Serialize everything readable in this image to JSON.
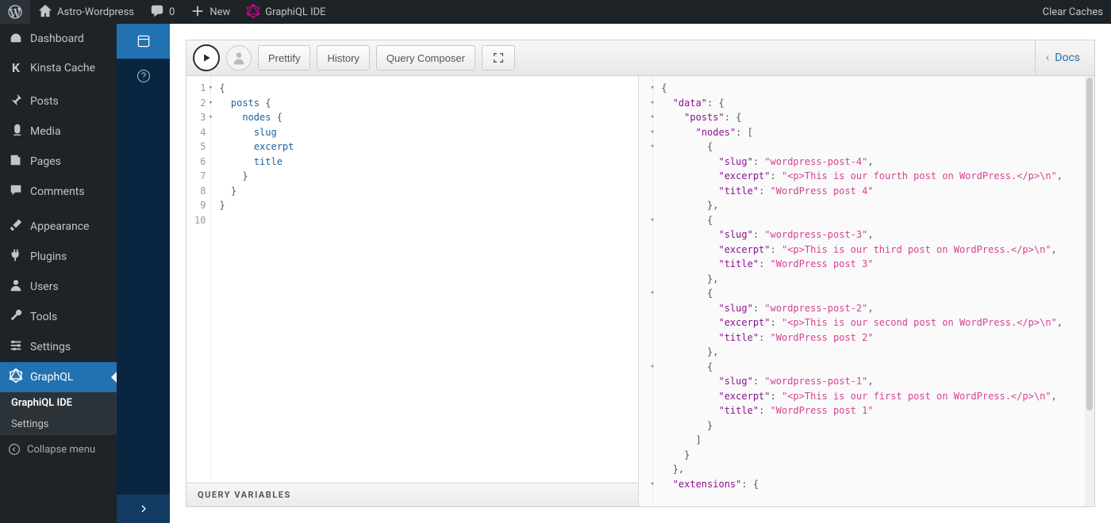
{
  "adminbar": {
    "site_name": "Astro-Wordpress",
    "comments_count": "0",
    "new_label": "New",
    "graphiql_label": "GraphiQL IDE",
    "clear_caches_label": "Clear Caches"
  },
  "adminmenu": {
    "items": [
      {
        "icon": "dash",
        "label": "Dashboard"
      },
      {
        "icon": "k",
        "label": "Kinsta Cache"
      },
      {
        "icon": "pin",
        "label": "Posts"
      },
      {
        "icon": "media",
        "label": "Media"
      },
      {
        "icon": "page",
        "label": "Pages"
      },
      {
        "icon": "comment",
        "label": "Comments"
      },
      {
        "icon": "brush",
        "label": "Appearance"
      },
      {
        "icon": "plug",
        "label": "Plugins"
      },
      {
        "icon": "user",
        "label": "Users"
      },
      {
        "icon": "wrench",
        "label": "Tools"
      },
      {
        "icon": "settings",
        "label": "Settings"
      },
      {
        "icon": "graphql",
        "label": "GraphQL"
      }
    ],
    "submenu": [
      "GraphiQL IDE",
      "Settings"
    ],
    "collapse_label": "Collapse menu"
  },
  "toolbar": {
    "prettify": "Prettify",
    "history": "History",
    "composer": "Query Composer",
    "docs": "Docs"
  },
  "query": {
    "lines": [
      "{",
      "  posts {",
      "    nodes {",
      "      slug",
      "      excerpt",
      "      title",
      "    }",
      "  }",
      "}",
      ""
    ],
    "fields": [
      "posts",
      "nodes",
      "slug",
      "excerpt",
      "title"
    ]
  },
  "query_variables_label": "QUERY VARIABLES",
  "result": {
    "posts": [
      {
        "slug": "wordpress-post-4",
        "excerpt": "<p>This is our fourth post on WordPress.</p>\\n",
        "title": "WordPress post 4"
      },
      {
        "slug": "wordpress-post-3",
        "excerpt": "<p>This is our third post on WordPress.</p>\\n",
        "title": "WordPress post 3"
      },
      {
        "slug": "wordpress-post-2",
        "excerpt": "<p>This is our second post on WordPress.</p>\\n",
        "title": "WordPress post 2"
      },
      {
        "slug": "wordpress-post-1",
        "excerpt": "<p>This is our first post on WordPress.</p>\\n",
        "title": "WordPress post 1"
      }
    ]
  }
}
